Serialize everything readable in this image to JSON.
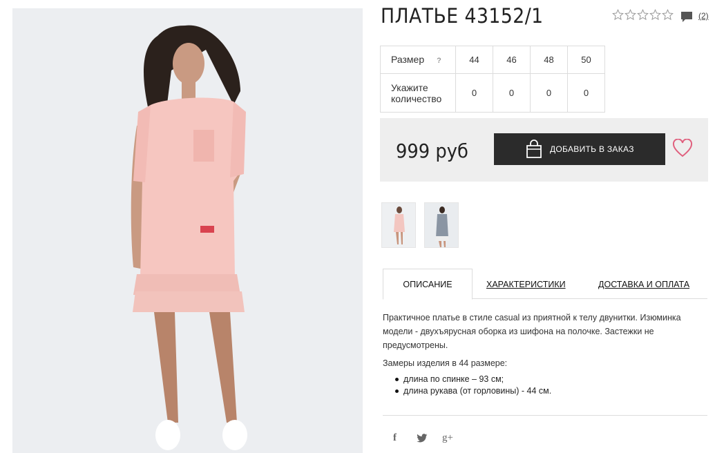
{
  "product": {
    "title": "ПЛАТЬЕ 43152/1",
    "rating_stars": 0,
    "rating_max": 5,
    "comments_count": "(2)"
  },
  "sizes_table": {
    "size_label": "Размер",
    "help_icon": "?",
    "qty_label_line1": "Укажите",
    "qty_label_line2": "количество",
    "sizes": [
      "44",
      "46",
      "48",
      "50"
    ],
    "quantities": [
      "0",
      "0",
      "0",
      "0"
    ]
  },
  "purchase": {
    "price": "999 руб",
    "add_button_label": "ДОБАВИТЬ В ЗАКАЗ",
    "bag_icon": "shopping-bag-icon",
    "wishlist_icon": "heart-icon",
    "accent_color": "#e0607e"
  },
  "tabs": [
    {
      "label": "ОПИСАНИЕ",
      "active": true
    },
    {
      "label": "ХАРАКТЕРИСТИКИ",
      "active": false
    },
    {
      "label": "ДОСТАВКА И ОПЛАТА",
      "active": false
    }
  ],
  "description": {
    "text": "Практичное платье в стиле casual из приятной к телу двунитки. Изюминка модели - двухъярусная оборка из шифона на полочке. Застежки не предусмотрены.",
    "measurements_title": "Замеры изделия в 44 размере:",
    "measurements": [
      "длина по спинке – 93 см;",
      "длина рукава (от горловины) - 44 см."
    ]
  },
  "social": {
    "facebook": "f",
    "twitter": "twitter-icon",
    "google_plus": "g+"
  }
}
